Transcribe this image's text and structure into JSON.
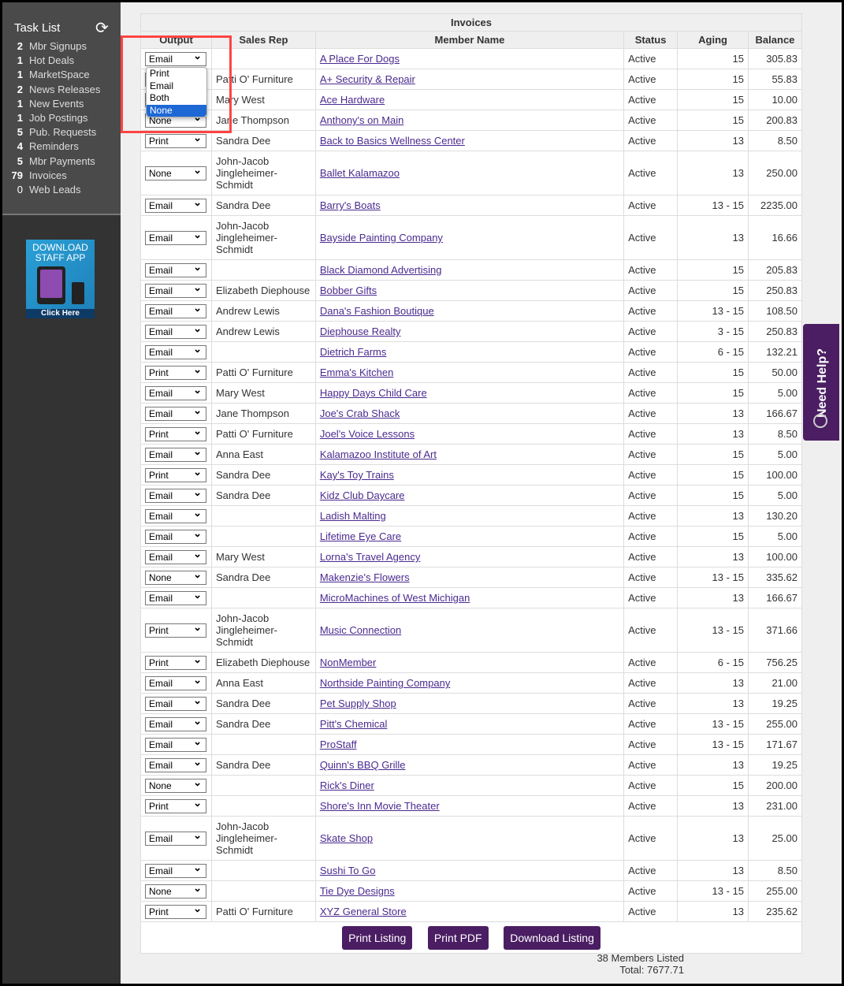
{
  "sidebar": {
    "title": "Task List",
    "items": [
      {
        "count": "2",
        "label": "Mbr Signups"
      },
      {
        "count": "1",
        "label": "Hot Deals"
      },
      {
        "count": "1",
        "label": "MarketSpace"
      },
      {
        "count": "2",
        "label": "News Releases"
      },
      {
        "count": "1",
        "label": "New Events"
      },
      {
        "count": "1",
        "label": "Job Postings"
      },
      {
        "count": "5",
        "label": "Pub. Requests"
      },
      {
        "count": "4",
        "label": "Reminders"
      },
      {
        "count": "5",
        "label": "Mbr Payments"
      },
      {
        "count": "79",
        "label": "Invoices"
      },
      {
        "count": "0",
        "label": "Web Leads"
      }
    ],
    "app_banner": {
      "line1": "DOWNLOAD",
      "line2": "STAFF APP",
      "cta": "Click Here"
    }
  },
  "table": {
    "title": "Invoices",
    "columns": [
      "Output",
      "Sales Rep",
      "Member Name",
      "Status",
      "Aging",
      "Balance"
    ],
    "rows": [
      [
        "Email",
        "",
        "A Place For Dogs",
        "Active",
        "15",
        "305.83"
      ],
      [
        "",
        "Patti O' Furniture",
        "A+ Security & Repair",
        "Active",
        "15",
        "55.83"
      ],
      [
        "",
        "Mary West",
        "Ace Hardware",
        "Active",
        "15",
        "10.00"
      ],
      [
        "None",
        "Jane Thompson",
        "Anthony's on Main",
        "Active",
        "15",
        "200.83"
      ],
      [
        "Print",
        "Sandra Dee",
        "Back to Basics Wellness Center",
        "Active",
        "13",
        "8.50"
      ],
      [
        "None",
        "John-Jacob Jingleheimer-Schmidt",
        "Ballet Kalamazoo",
        "Active",
        "13",
        "250.00"
      ],
      [
        "Email",
        "Sandra Dee",
        "Barry's Boats",
        "Active",
        "13 - 15",
        "2235.00"
      ],
      [
        "Email",
        "John-Jacob Jingleheimer-Schmidt",
        "Bayside Painting Company",
        "Active",
        "13",
        "16.66"
      ],
      [
        "Email",
        "",
        "Black Diamond Advertising",
        "Active",
        "15",
        "205.83"
      ],
      [
        "Email",
        "Elizabeth Diephouse",
        "Bobber Gifts",
        "Active",
        "15",
        "250.83"
      ],
      [
        "Email",
        "Andrew Lewis",
        "Dana's Fashion Boutique",
        "Active",
        "13 - 15",
        "108.50"
      ],
      [
        "Email",
        "Andrew Lewis",
        "Diephouse Realty",
        "Active",
        "3 - 15",
        "250.83"
      ],
      [
        "Email",
        "",
        "Dietrich Farms",
        "Active",
        "6 - 15",
        "132.21"
      ],
      [
        "Print",
        "Patti O' Furniture",
        "Emma's Kitchen",
        "Active",
        "15",
        "50.00"
      ],
      [
        "Email",
        "Mary West",
        "Happy Days Child Care",
        "Active",
        "15",
        "5.00"
      ],
      [
        "Email",
        "Jane Thompson",
        "Joe's Crab Shack",
        "Active",
        "13",
        "166.67"
      ],
      [
        "Print",
        "Patti O' Furniture",
        "Joel's Voice Lessons",
        "Active",
        "13",
        "8.50"
      ],
      [
        "Email",
        "Anna East",
        "Kalamazoo Institute of Art",
        "Active",
        "15",
        "5.00"
      ],
      [
        "Print",
        "Sandra Dee",
        "Kay's Toy Trains",
        "Active",
        "15",
        "100.00"
      ],
      [
        "Email",
        "Sandra Dee",
        "Kidz Club Daycare",
        "Active",
        "15",
        "5.00"
      ],
      [
        "Email",
        "",
        "Ladish Malting",
        "Active",
        "13",
        "130.20"
      ],
      [
        "Email",
        "",
        "Lifetime Eye Care",
        "Active",
        "15",
        "5.00"
      ],
      [
        "Email",
        "Mary West",
        "Lorna's Travel Agency",
        "Active",
        "13",
        "100.00"
      ],
      [
        "None",
        "Sandra Dee",
        "Makenzie's Flowers",
        "Active",
        "13 - 15",
        "335.62"
      ],
      [
        "Email",
        "",
        "MicroMachines of West Michigan",
        "Active",
        "13",
        "166.67"
      ],
      [
        "Print",
        "John-Jacob Jingleheimer-Schmidt",
        "Music Connection",
        "Active",
        "13 - 15",
        "371.66"
      ],
      [
        "Print",
        "Elizabeth Diephouse",
        "NonMember",
        "Active",
        "6 - 15",
        "756.25"
      ],
      [
        "Email",
        "Anna East",
        "Northside Painting Company",
        "Active",
        "13",
        "21.00"
      ],
      [
        "Email",
        "Sandra Dee",
        "Pet Supply Shop",
        "Active",
        "13",
        "19.25"
      ],
      [
        "Email",
        "Sandra Dee",
        "Pitt's Chemical",
        "Active",
        "13 - 15",
        "255.00"
      ],
      [
        "Email",
        "",
        "ProStaff",
        "Active",
        "13 - 15",
        "171.67"
      ],
      [
        "Email",
        "Sandra Dee",
        "Quinn's BBQ Grille",
        "Active",
        "13",
        "19.25"
      ],
      [
        "None",
        "",
        "Rick's Diner",
        "Active",
        "15",
        "200.00"
      ],
      [
        "Print",
        "",
        "Shore's Inn Movie Theater",
        "Active",
        "13",
        "231.00"
      ],
      [
        "Email",
        "John-Jacob Jingleheimer-Schmidt",
        "Skate Shop",
        "Active",
        "13",
        "25.00"
      ],
      [
        "Email",
        "",
        "Sushi To Go",
        "Active",
        "13",
        "8.50"
      ],
      [
        "None",
        "",
        "Tie Dye Designs",
        "Active",
        "13 - 15",
        "255.00"
      ],
      [
        "Print",
        "Patti O' Furniture",
        "XYZ General Store",
        "Active",
        "13",
        "235.62"
      ]
    ]
  },
  "dropdown": {
    "options": [
      "Print",
      "Email",
      "Both",
      "None"
    ],
    "highlighted": "None"
  },
  "buttons": {
    "print_listing": "Print Listing",
    "print_pdf": "Print PDF",
    "download_listing": "Download Listing"
  },
  "footer": {
    "count": "38 Members Listed",
    "total": "Total: 7677.71"
  },
  "help_tab": "Need Help?",
  "colors": {
    "accent": "#4b1e63",
    "link": "#4b2a8f",
    "highlight": "#ff4444"
  }
}
